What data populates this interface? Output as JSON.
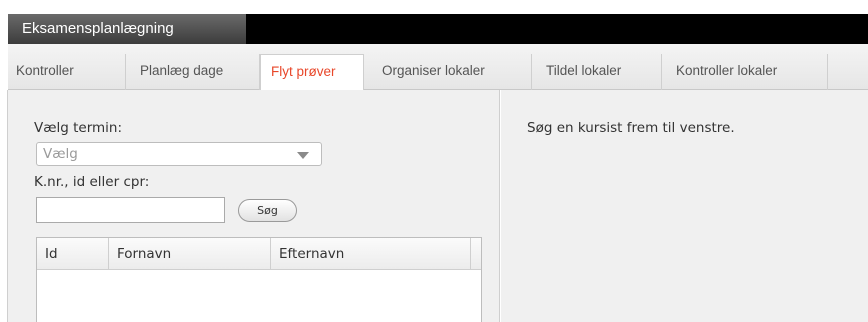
{
  "app": {
    "title": "Eksamensplanlægning"
  },
  "tabs": [
    {
      "label": "Kontroller",
      "active": false
    },
    {
      "label": "Planlæg dage",
      "active": false
    },
    {
      "label": "Flyt prøver",
      "active": true
    },
    {
      "label": "Organiser lokaler",
      "active": false
    },
    {
      "label": "Tildel lokaler",
      "active": false
    },
    {
      "label": "Kontroller lokaler",
      "active": false
    }
  ],
  "left": {
    "term_label": "Vælg termin:",
    "term_select_value": "Vælg",
    "search_label": "K.nr., id eller cpr:",
    "search_value": "",
    "search_button": "Søg",
    "table_headers": [
      "Id",
      "Fornavn",
      "Efternavn"
    ]
  },
  "right": {
    "message": "Søg en kursist frem til venstre."
  },
  "colors": {
    "active_tab": "#e8472a",
    "titlebar": "#000000"
  }
}
